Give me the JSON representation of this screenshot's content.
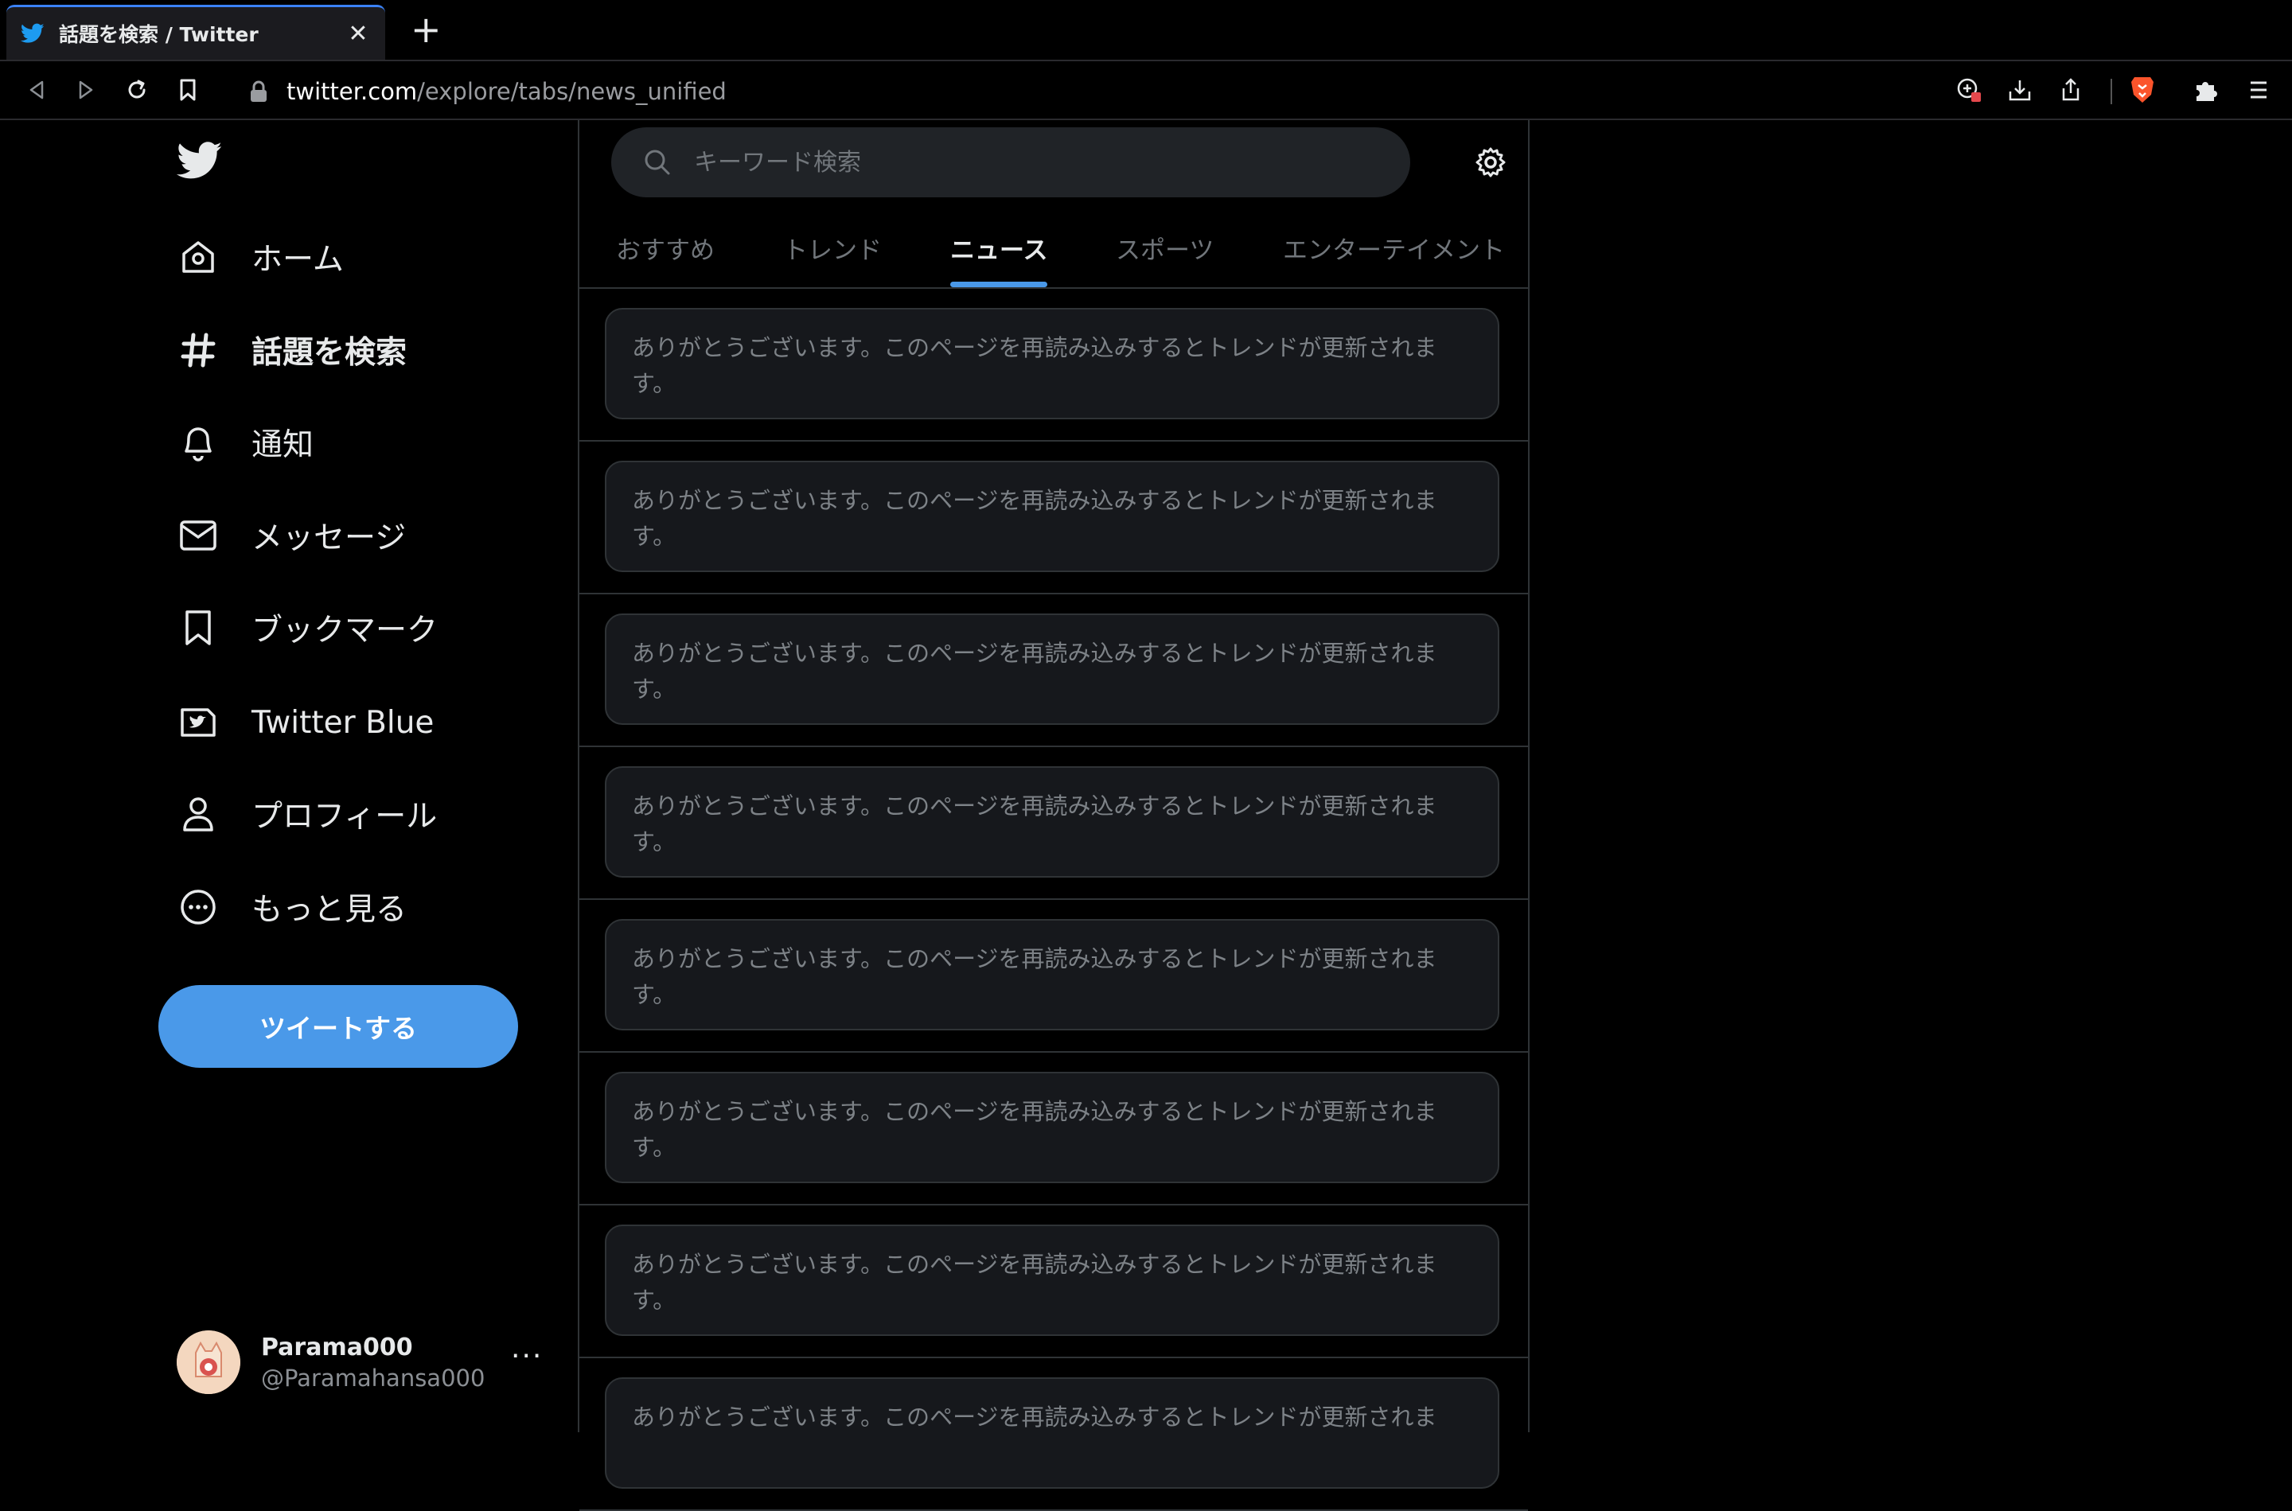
{
  "browser": {
    "tab_title": "話題を検索 / Twitter",
    "url_host": "twitter.com",
    "url_path": "/explore/tabs/news_unified"
  },
  "sidebar": {
    "items": [
      {
        "label": "ホーム",
        "icon": "home-icon"
      },
      {
        "label": "話題を検索",
        "icon": "hashtag-icon",
        "active": true
      },
      {
        "label": "通知",
        "icon": "bell-icon"
      },
      {
        "label": "メッセージ",
        "icon": "envelope-icon"
      },
      {
        "label": "ブックマーク",
        "icon": "bookmark-icon"
      },
      {
        "label": "Twitter Blue",
        "icon": "twitter-blue-icon"
      },
      {
        "label": "プロフィール",
        "icon": "person-icon"
      },
      {
        "label": "もっと見る",
        "icon": "more-circle-icon"
      }
    ],
    "tweet_button": "ツイートする",
    "account": {
      "name": "Parama000",
      "handle": "@Paramahansa000",
      "more": "···"
    }
  },
  "explore": {
    "search_placeholder": "キーワード検索",
    "tabs": [
      {
        "label": "おすすめ"
      },
      {
        "label": "トレンド"
      },
      {
        "label": "ニュース",
        "active": true
      },
      {
        "label": "スポーツ"
      },
      {
        "label": "エンターテイメント"
      }
    ],
    "notices": [
      "ありがとうございます。このページを再読み込みするとトレンドが更新されます。",
      "ありがとうございます。このページを再読み込みするとトレンドが更新されます。",
      "ありがとうございます。このページを再読み込みするとトレンドが更新されます。",
      "ありがとうございます。このページを再読み込みするとトレンドが更新されます。",
      "ありがとうございます。このページを再読み込みするとトレンドが更新されます。",
      "ありがとうございます。このページを再読み込みするとトレンドが更新されます。",
      "ありがとうございます。このページを再読み込みするとトレンドが更新されます。",
      "ありがとうございます。このページを再読み込みするとトレンドが更新されま"
    ]
  },
  "colors": {
    "accent": "#4a99e9",
    "background": "#000000",
    "border": "#2f3336"
  }
}
